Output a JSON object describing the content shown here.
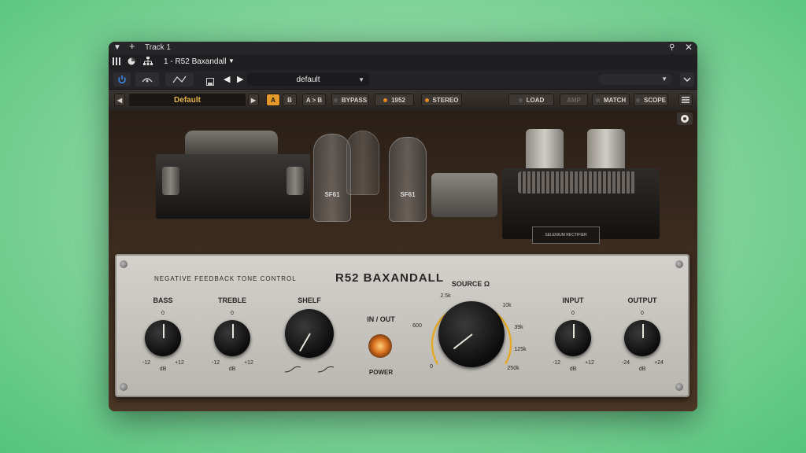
{
  "window": {
    "track_title": "Track 1",
    "plugin_slot": "1 - R52 Baxandall"
  },
  "header": {
    "preset_default": "default"
  },
  "toolbar": {
    "preset_name": "Default",
    "a_label": "A",
    "b_label": "B",
    "ab_copy_label": "A > B",
    "bypass_label": "BYPASS",
    "year_label": "1952",
    "stereo_label": "STEREO",
    "load_label": "LOAD",
    "amp_label": "AMP",
    "match_label": "MATCH",
    "scope_label": "SCOPE"
  },
  "tubes": {
    "left": "SF61",
    "right": "SF61"
  },
  "rectifier_label": "SELENIUM RECTIFIER",
  "panel": {
    "subtitle": "NEGATIVE FEEDBACK TONE CONTROL",
    "title": "R52 BAXANDALL",
    "bass": {
      "label": "BASS",
      "top": "0",
      "min": "-12",
      "max": "+12",
      "unit": "dB"
    },
    "treble": {
      "label": "TREBLE",
      "top": "0",
      "min": "-12",
      "max": "+12",
      "unit": "dB"
    },
    "shelf": {
      "label": "SHELF"
    },
    "inout": {
      "label": "IN / OUT",
      "power": "POWER"
    },
    "source": {
      "label": "SOURCE Ω",
      "ticks": [
        "0",
        "600",
        "2.5k",
        "10k",
        "39k",
        "125k",
        "250k"
      ]
    },
    "input": {
      "label": "INPUT",
      "top": "0",
      "min": "-12",
      "max": "+12",
      "unit": "dB"
    },
    "output": {
      "label": "OUTPUT",
      "top": "0",
      "min": "-24",
      "max": "+24",
      "unit": "dB"
    }
  }
}
